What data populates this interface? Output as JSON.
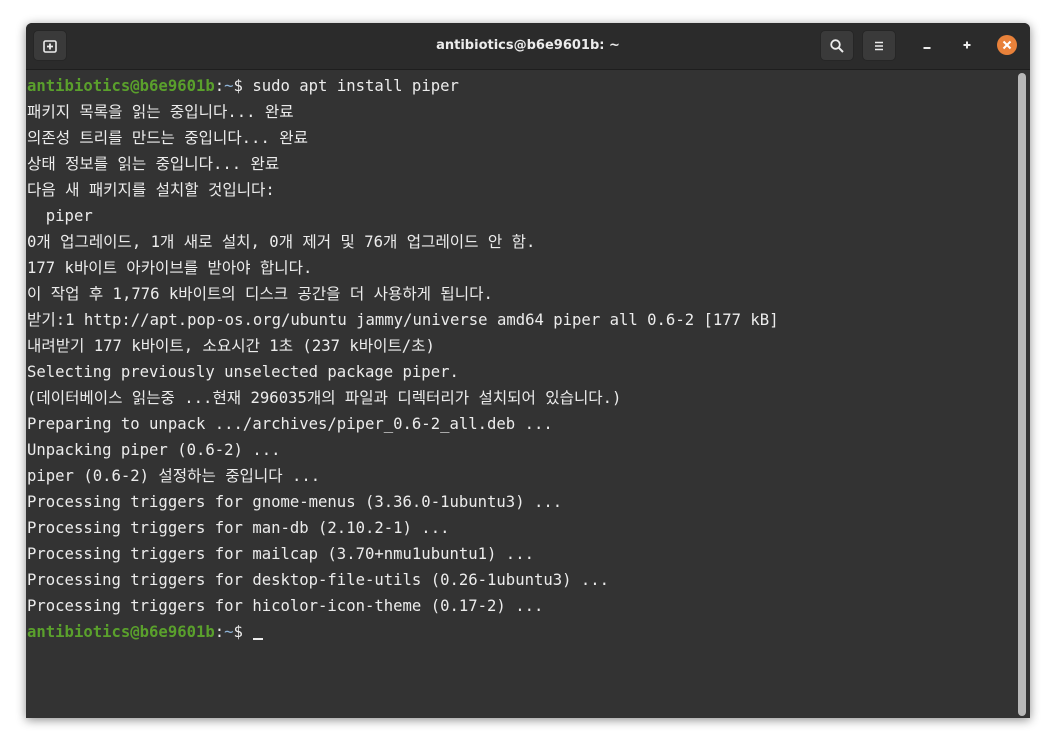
{
  "window": {
    "title": "antibiotics@b6e9601b: ~"
  },
  "prompt": {
    "user_host": "antibiotics@b6e9601b",
    "sep": ":",
    "path": "~",
    "symbol": "$ "
  },
  "command": "sudo apt install piper",
  "output": [
    "패키지 목록을 읽는 중입니다... 완료",
    "의존성 트리를 만드는 중입니다... 완료",
    "상태 정보를 읽는 중입니다... 완료",
    "다음 새 패키지를 설치할 것입니다:",
    "  piper",
    "0개 업그레이드, 1개 새로 설치, 0개 제거 및 76개 업그레이드 안 함.",
    "177 k바이트 아카이브를 받아야 합니다.",
    "이 작업 후 1,776 k바이트의 디스크 공간을 더 사용하게 됩니다.",
    "받기:1 http://apt.pop-os.org/ubuntu jammy/universe amd64 piper all 0.6-2 [177 kB]",
    "내려받기 177 k바이트, 소요시간 1초 (237 k바이트/초)",
    "Selecting previously unselected package piper.",
    "(데이터베이스 읽는중 ...현재 296035개의 파일과 디렉터리가 설치되어 있습니다.)",
    "Preparing to unpack .../archives/piper_0.6-2_all.deb ...",
    "Unpacking piper (0.6-2) ...",
    "piper (0.6-2) 설정하는 중입니다 ...",
    "Processing triggers for gnome-menus (3.36.0-1ubuntu3) ...",
    "Processing triggers for man-db (2.10.2-1) ...",
    "Processing triggers for mailcap (3.70+nmu1ubuntu1) ...",
    "Processing triggers for desktop-file-utils (0.26-1ubuntu3) ...",
    "Processing triggers for hicolor-icon-theme (0.17-2) ..."
  ],
  "icons": {
    "new_tab": "new-tab-icon",
    "search": "search-icon",
    "menu": "hamburger-menu-icon",
    "minimize": "minimize-icon",
    "maximize": "maximize-icon",
    "close": "close-icon"
  },
  "colors": {
    "prompt_user": "#5aa02c",
    "prompt_path": "#8fb4d8",
    "close_button": "#e8813a",
    "background": "#333333"
  }
}
